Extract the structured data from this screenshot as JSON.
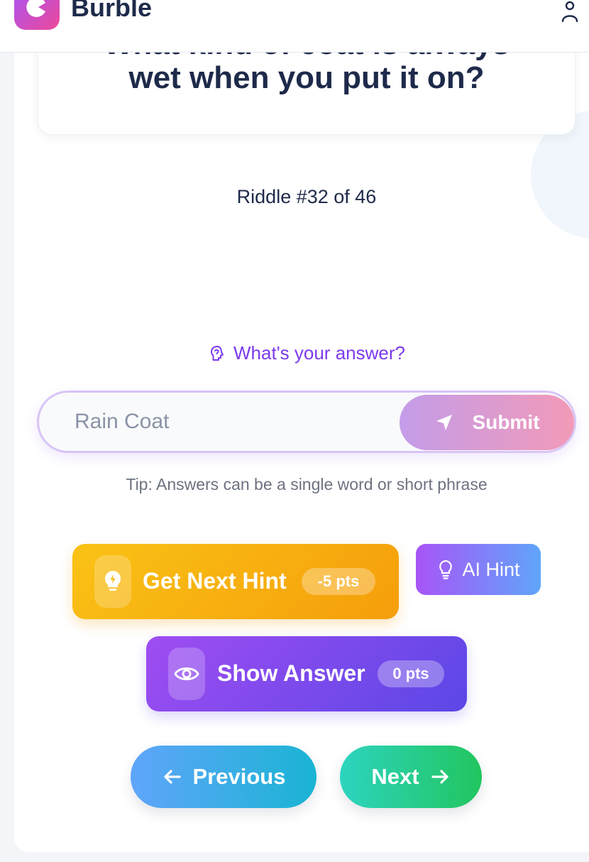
{
  "header": {
    "app_name": "Burble",
    "logo_icon": "app-logo-icon",
    "user_icon": "user-icon"
  },
  "riddle": {
    "question_line_1": "What kind of coat is always",
    "question_line_2": "wet when you put it on?",
    "counter": "Riddle #32 of 46"
  },
  "answer": {
    "prompt": "What's your answer?",
    "prompt_icon": "brain-icon",
    "value": "Rain Coat",
    "submit_label": "Submit",
    "submit_icon": "send-icon",
    "tip": "Tip: Answers can be a single word or short phrase"
  },
  "hints": {
    "next_hint_label": "Get Next Hint",
    "next_hint_cost": "-5 pts",
    "next_hint_icon": "lightbulb-icon",
    "ai_hint_label": "AI Hint",
    "ai_hint_icon": "lightbulb-outline-icon",
    "show_answer_label": "Show Answer",
    "show_answer_cost": "0 pts",
    "show_answer_icon": "eye-icon"
  },
  "navigation": {
    "previous_label": "Previous",
    "next_label": "Next"
  },
  "colors": {
    "primary_text": "#1e2a4a",
    "accent_purple": "#7c3aed",
    "hint_orange": "#f59e0b",
    "next_green": "#22c55e"
  }
}
